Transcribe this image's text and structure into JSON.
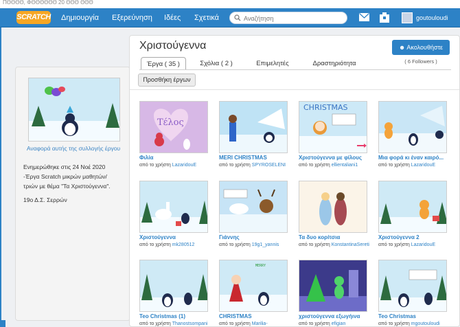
{
  "top_strip": "ΠΘΘΘΘ, ΦΘΘΘΘΘΘ 20 ΘΘΘ ΘΘΘ",
  "nav": {
    "logo": "SCRATCH",
    "items": [
      "Δημιουργία",
      "Εξερεύνηση",
      "Ιδέες",
      "Σχετικά"
    ],
    "search_placeholder": "Αναζήτηση",
    "username": "goutouloudi"
  },
  "studio": {
    "title": "Χριστούγεννα",
    "follow_label": "Ακολουθήστε",
    "followers": "( 6 Followers )",
    "tabs": [
      "Έργα ( 35 )",
      "Σχόλια ( 2 )",
      "Επιμελητές",
      "Δραστηριότητα"
    ],
    "add_projects": "Προσθήκη έργων"
  },
  "sidebar": {
    "report_link": "Αναφορά αυτής της συλλογής έργου",
    "description_lines": [
      "Ενημερώθηκε στις 24 Νοέ 2020",
      "-Έργα Scratch μικρών μαθητών/",
      "τριών με θέμα \"Τα Χριστούγεννα\"."
    ],
    "school": "19ο Δ.Σ. Σερρών"
  },
  "projects": [
    {
      "title": "Φιλία",
      "by": "από το χρήστη",
      "author": "LazaridouE",
      "thumb": "pink"
    },
    {
      "title": "MERI CHRISTMAS",
      "by": "από το χρήστη",
      "author": "SPYROSELENI",
      "thumb": "snow-figure"
    },
    {
      "title": "Χριστούγεννα με φίλους",
      "by": "από το χρήστη",
      "author": "ellientaliani1",
      "thumb": "christmas-text"
    },
    {
      "title": "Μια φορά κι έναν καιρό...",
      "by": "από το χρήστη",
      "author": "LazaridouE",
      "thumb": "snow-cat"
    },
    {
      "title": "Χριστούγεννα",
      "by": "από το χρήστη",
      "author": "mk280512",
      "thumb": "unicorn"
    },
    {
      "title": "Γιάννης",
      "by": "από το χρήστη",
      "author": "19g1_yannis",
      "thumb": "bear-reindeer"
    },
    {
      "title": "Τα δυο κορίτσια",
      "by": "από το χρήστη",
      "author": "KonstantinaSereti",
      "thumb": "girls"
    },
    {
      "title": "Χριστούγεννα 2",
      "by": "από το χρήστη",
      "author": "LazaridouE",
      "thumb": "cat-gift"
    },
    {
      "title": "Teo Christmas (1)",
      "by": "από το χρήστη",
      "author": "Thanostsompani",
      "thumb": "teo"
    },
    {
      "title": "CHRISTMAS",
      "by": "από το χρήστη",
      "author": "Marilia-",
      "thumb": "red-girl"
    },
    {
      "title": "χριστούγεννα εξωγήινα",
      "by": "από το χρήστη",
      "author": "efigian",
      "thumb": "alien"
    },
    {
      "title": "Teo Christmas",
      "by": "από το χρήστη",
      "author": "mgoutouloudi",
      "thumb": "teo2"
    }
  ],
  "colors": {
    "nav": "#2d82c6",
    "link": "#2d82c6",
    "logo": "#f6a623"
  }
}
